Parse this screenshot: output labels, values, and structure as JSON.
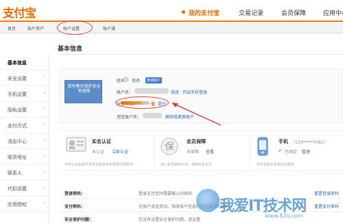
{
  "header": {
    "logo": "支付宝",
    "nav": [
      "我的支付宝",
      "交易记录",
      "会员保障",
      "应用中心"
    ],
    "active_nav": 0
  },
  "subnav": {
    "items": [
      "首页",
      "账户资产",
      "账户设置",
      "账户通"
    ],
    "highlighted": 2
  },
  "sidebar": {
    "items": [
      {
        "label": "基本信息",
        "active": true
      },
      {
        "label": "安全设置"
      },
      {
        "label": "手机设置"
      },
      {
        "label": "隐私设置"
      },
      {
        "label": "支付方式"
      },
      {
        "label": "消息中心"
      },
      {
        "label": "收货地址"
      },
      {
        "label": "联系人"
      },
      {
        "label": "代扣设置"
      },
      {
        "label": "应用授权"
      }
    ]
  },
  "main": {
    "title": "基本信息",
    "avatar_text": "我有春天保护安全有保障",
    "name_label": "姓名：",
    "name_edit": "修改",
    "name_badge": "普通账户",
    "account_label": "账户名：",
    "account_edit": "修改",
    "account_mobile_login": "开启手机登录",
    "security_label": "安全等级：",
    "security_level": "低",
    "security_upgrade": "提升",
    "taobao_label": "淘宝账户名：",
    "taobao_link": "解绑或更换账户",
    "security_progress": 0.75,
    "cards": [
      {
        "title": "实名认证",
        "status": "未认证",
        "action": "立即认证",
        "desc": "升级认证后即可享受资金服务和便捷付款服务",
        "icon": "id-card-icon"
      },
      {
        "title": "会员保障",
        "status": "未保障",
        "action": "查看",
        "desc": "加入会员保障计划，保障资金安全",
        "icon": "shield-bao-icon"
      },
      {
        "title": "手机",
        "phone": "（133*****7081）",
        "status": "已绑定",
        "action": "管理",
        "desc": "您可享有手机相关的服务",
        "icon": "mobile-phone-icon"
      }
    ],
    "rows": [
      {
        "label": "登录密码：",
        "desc": "登录支付宝时需要输入的密码",
        "action": "重置登录密码"
      },
      {
        "label": "支付密码：",
        "desc": "在账户资金变动、修改账户信息时需要输入的密码",
        "action": "重置支付密码"
      },
      {
        "label": "安全保护问题：",
        "desc": "您没有设置安全保护问题，请设置",
        "action": ""
      }
    ]
  },
  "watermark": {
    "text": "我爱IT技术网",
    "url": "www.52ij.com"
  },
  "colors": {
    "brand": "#e56a00",
    "link": "#2a6ab5",
    "annotation": "#d44444"
  }
}
